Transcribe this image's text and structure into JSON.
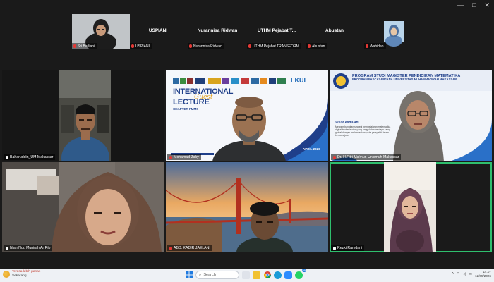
{
  "window": {
    "minimize": "—",
    "maximize": "□",
    "close": "✕"
  },
  "strip": [
    {
      "name": "",
      "caption": "Sri Barliani",
      "muted": true,
      "has_video": true
    },
    {
      "name": "USPIANI",
      "caption": "USPIANI",
      "muted": true,
      "has_video": false
    },
    {
      "name": "Nurannisa Ridwan",
      "caption": "Nurannisa Ridwan",
      "muted": true,
      "has_video": false
    },
    {
      "name": "UTHM Pejabat T...",
      "caption": "UTHM Pejabat TRANSFORM",
      "muted": true,
      "has_video": false
    },
    {
      "name": "Abustan",
      "caption": "Abustan",
      "muted": true,
      "has_video": false
    },
    {
      "name": "",
      "caption": "Wahidah",
      "muted": true,
      "has_video": true
    }
  ],
  "tiles": [
    {
      "caption": "Baharuddin_UM Makassar",
      "muted": false
    },
    {
      "caption": "Mohamad Zaky",
      "muted": true
    },
    {
      "caption": "Dr. H.Fitri Ma'mur, Unismuh Makassar",
      "muted": true
    },
    {
      "caption": "Nian Nor. Munirah Ar Rib",
      "muted": false
    },
    {
      "caption": "ABD. KADIR JAELANI",
      "muted": true
    },
    {
      "caption": "Rezki Ramdani",
      "muted": false
    }
  ],
  "slide_lecture": {
    "title_line1": "INTERNATIONAL",
    "title_line2": "Guest",
    "title_line3": "LECTURE",
    "subtitle": "CHAPTER FMMS",
    "date": "APRIL 2026",
    "logo_text": "LKUI"
  },
  "slide_program": {
    "line1": "PROGRAM STUDI MAGISTER PENDIDIKAN MATEMATIKA",
    "line2": "PROGRAM PASCASARJANA UNIVERSITAS MUHAMMADIYAH MAKASSAR",
    "vision_title": "Visi Kelimuan",
    "vision_text": "Mengembangkan strategi pembelajaran matematika digital berbasis nilai yang unggul dan berdaya saing global dengan berlandaskan pada perspektif Islam berkemajuan"
  },
  "taskbar": {
    "weather_line1": "Terasa lebih panas",
    "weather_line2": "Sekarang",
    "search_label": "Search",
    "badge": "99",
    "time": "14:07",
    "date": "12/05/2026"
  }
}
